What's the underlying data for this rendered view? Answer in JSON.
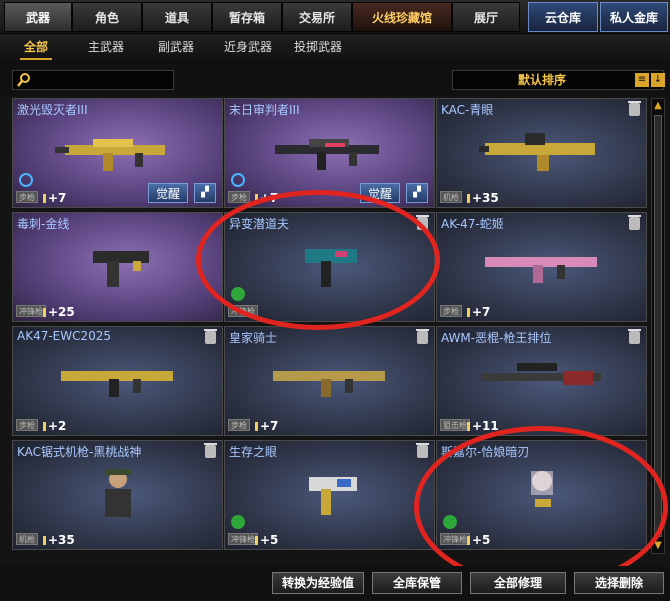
{
  "top_tabs": [
    "武器",
    "角色",
    "道具",
    "暂存箱",
    "交易所",
    "火线珍藏馆",
    "展厅",
    "云仓库",
    "私人金库"
  ],
  "sub_tabs": [
    "全部",
    "主武器",
    "副武器",
    "近身武器",
    "投掷武器"
  ],
  "search": {
    "placeholder": ""
  },
  "sort": {
    "label": "默认排序"
  },
  "items": [
    {
      "name": "激光毁灭者III",
      "category": "步枪",
      "level": "+7",
      "awaken": "觉醒"
    },
    {
      "name": "末日审判者III",
      "category": "步枪",
      "level": "+7",
      "awaken": "觉醒"
    },
    {
      "name": "KAC-青眼",
      "category": "机枪",
      "level": "+35"
    },
    {
      "name": "毒刺-金线",
      "category": "冲锋枪",
      "level": "+25"
    },
    {
      "name": "异变潜道夫",
      "category": "冲锋枪",
      "level": ""
    },
    {
      "name": "AK-47-蛇姬",
      "category": "步枪",
      "level": "+7"
    },
    {
      "name": "AK47-EWC2025",
      "category": "步枪",
      "level": "+2"
    },
    {
      "name": "皇家骑士",
      "category": "步枪",
      "level": "+7"
    },
    {
      "name": "AWM-恶棍-枪王排位",
      "category": "狙击枪",
      "level": "+11"
    },
    {
      "name": "KAC锯式机枪-黑桃战神",
      "category": "机枪",
      "level": "+35"
    },
    {
      "name": "生存之眼",
      "category": "冲锋枪",
      "level": "+5"
    },
    {
      "name": "斯嘉尔-恰娘暗刃",
      "category": "冲锋枪",
      "level": "+5"
    }
  ],
  "bottom_buttons": [
    "转换为经验值",
    "全库保管",
    "全部修理",
    "选择删除"
  ],
  "colors": {
    "annotation": "#e0241f",
    "accent": "#d9a52a",
    "name_text": "#a9c8ff"
  }
}
